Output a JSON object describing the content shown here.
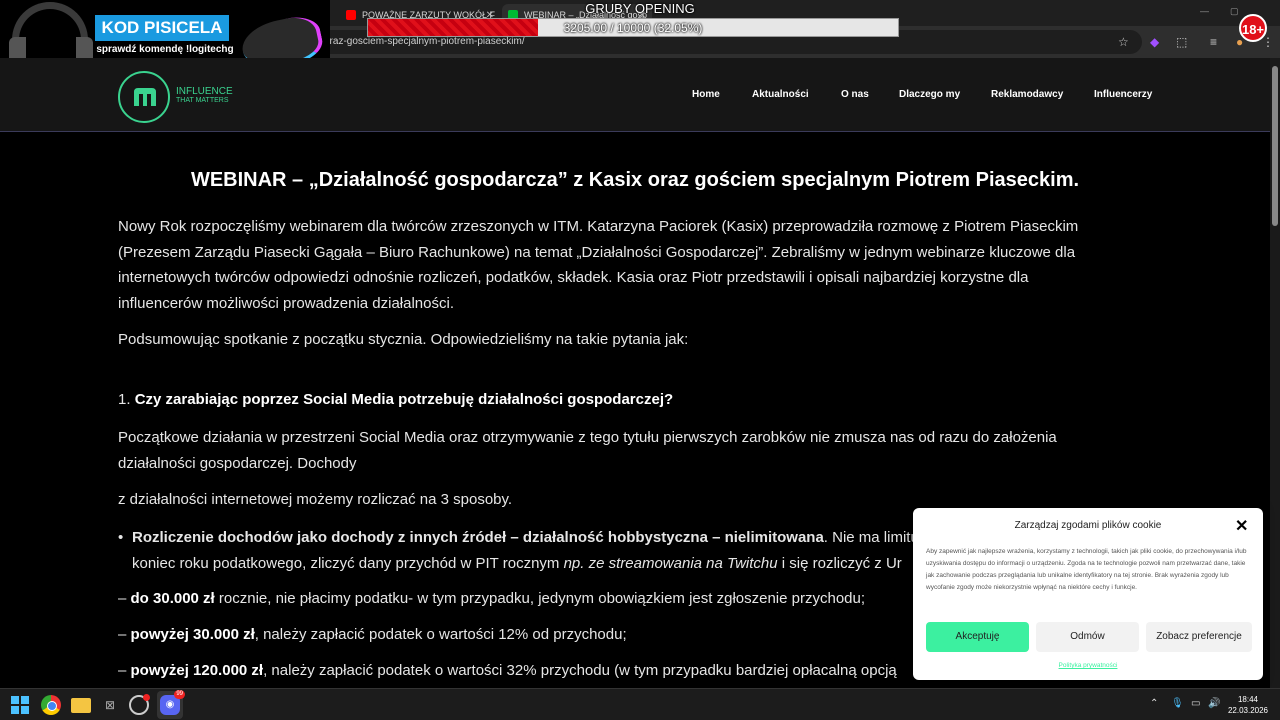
{
  "browser": {
    "tabs": [
      {
        "label": "POWAŻNE ZARZUTY WOKÓŁ F",
        "favicon_color": "#ff0000"
      },
      {
        "label": "WEBINAR – „Działalność gosp",
        "favicon_color": "#3ad38f"
      }
    ],
    "url": "oraz-gosciem-specjalnym-piotrem-piaseckim/",
    "icons": [
      "star-icon",
      "extension-icon",
      "puzzle-icon",
      "media-icon",
      "profile-icon",
      "menu-icon"
    ]
  },
  "overlay": {
    "promo_code": "KOD PISICELA",
    "promo_sub": "sprawdź komendę !logitechg",
    "stream_title": "GRUBY OPENING",
    "goal_text": "3205.00 / 10000 (32.05%)",
    "goal_fraction": 0.3205,
    "age_badge": "18+"
  },
  "site": {
    "logo_line1": "INFLUENCE",
    "logo_line2": "THAT MATTERS",
    "accent": "#3ad38f",
    "nav": [
      "Home",
      "Aktualności",
      "O nas",
      "Dlaczego my",
      "Reklamodawcy",
      "Influencerzy"
    ]
  },
  "article": {
    "title": "WEBINAR – „Działalność gospodarcza” z Kasix oraz gościem specjalnym Piotrem Piaseckim.",
    "intro": "Nowy Rok rozpoczęliśmy webinarem dla twórców zrzeszonych w ITM. Katarzyna Paciorek (Kasix) przeprowadziła rozmowę z Piotrem Piaseckim (Prezesem Zarządu Piasecki Gągała – Biuro Rachunkowe) na temat „Działalności Gospodarczej”. Zebraliśmy w jednym webinarze kluczowe dla internetowych twórców odpowiedzi odnośnie rozliczeń, podatków, składek. Kasia oraz Piotr przedstawili i opisali najbardziej korzystne dla influencerów możliwości prowadzenia działalności.",
    "summary": "Podsumowując spotkanie z początku stycznia. Odpowiedzieliśmy na takie pytania jak:",
    "q1_number": "1.",
    "q1": "Czy zarabiając poprzez Social Media potrzebuję działalności gospodarczej?",
    "a1": "Początkowe działania w przestrzeni Social Media oraz otrzymywanie z tego tytułu pierwszych zarobków nie zmusza nas od razu do założenia działalności gospodarczej. Dochody",
    "a1b": "z działalności internetowej możemy rozliczać na 3 sposoby.",
    "bullet_bold": "Rozliczenie dochodów jako dochody z innych źródeł – działalność hobbystyczna – nielimitowana",
    "bullet_rest": ". Nie ma limitu p",
    "bullet_line2_a": "koniec roku podatkowego, zliczyć dany przychód w PIT rocznym ",
    "bullet_line2_em": "np. ze streamowania na Twitchu",
    "bullet_line2_b": " i się rozliczyć z Ur",
    "dash1_bold": "do 30.000 zł",
    "dash1_rest": " rocznie, nie płacimy podatku- w tym przypadku, jedynym obowiązkiem jest zgłoszenie przychodu;",
    "dash2_bold": "powyżej 30.000 zł",
    "dash2_rest": ", należy zapłacić podatek o wartości 12% od przychodu;",
    "dash3_bold": "powyżej 120.000 zł",
    "dash3_rest": ", należy zapłacić podatek o wartości 32% przychodu (w tym przypadku bardziej opłacalną opcją",
    "dash_prefix": "– "
  },
  "cookie": {
    "title": "Zarządzaj zgodami plików cookie",
    "body": "Aby zapewnić jak najlepsze wrażenia, korzystamy z technologii, takich jak pliki cookie, do przechowywania i/lub uzyskiwania dostępu do informacji o urządzeniu. Zgoda na te technologie pozwoli nam przetwarzać dane, takie jak zachowanie podczas przeglądania lub unikalne identyfikatory na tej stronie. Brak wyrażenia zgody lub wycofanie zgody może niekorzystnie wpłynąć na niektóre cechy i funkcje.",
    "accept": "Akceptuję",
    "deny": "Odmów",
    "prefs": "Zobacz preferencje",
    "link": "Polityka prywatności",
    "accept_color": "#3cf0a0"
  },
  "taskbar": {
    "discord_badge": "99",
    "time": "18:44",
    "date": "22.03.2026"
  }
}
